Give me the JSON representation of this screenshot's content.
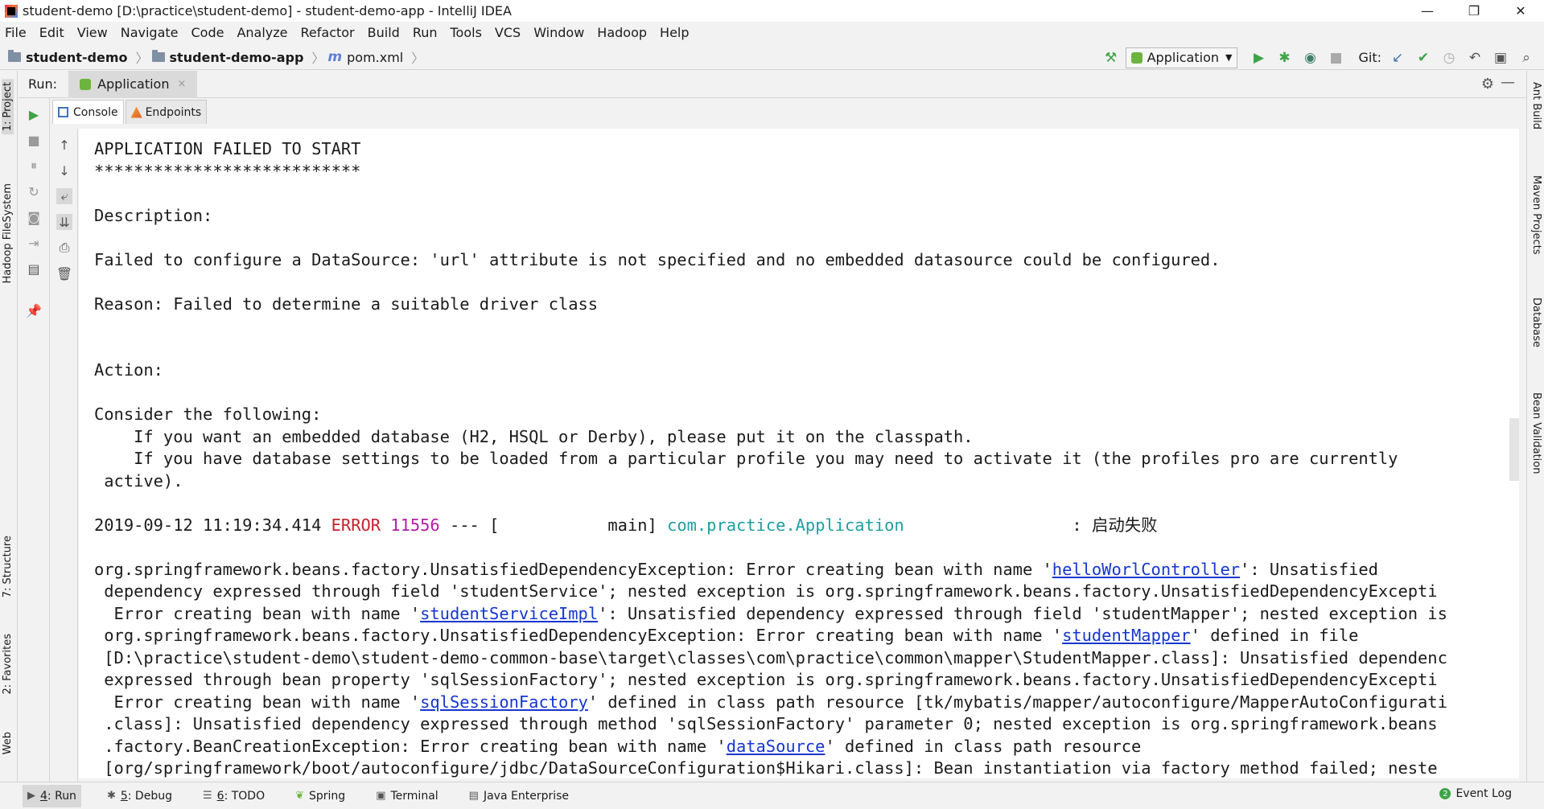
{
  "window": {
    "title": "student-demo [D:\\practice\\student-demo] - student-demo-app - IntelliJ IDEA",
    "minimize": "—",
    "restore": "❐",
    "close": "✕"
  },
  "menu": [
    "File",
    "Edit",
    "View",
    "Navigate",
    "Code",
    "Analyze",
    "Refactor",
    "Build",
    "Run",
    "Tools",
    "VCS",
    "Window",
    "Hadoop",
    "Help"
  ],
  "breadcrumb": {
    "project": "student-demo",
    "module": "student-demo-app",
    "file_icon": "m",
    "file": "pom.xml",
    "sep": "〉"
  },
  "toolbar": {
    "run_config": "Application",
    "git_label": "Git:"
  },
  "run_window": {
    "label": "Run:",
    "tab": "Application",
    "tab_close": "×"
  },
  "console_tabs": {
    "console": "Console",
    "endpoints": "Endpoints"
  },
  "left_tabs": [
    "1: Project",
    "Hadoop FileSystem",
    "7: Structure",
    "2: Favorites",
    "Web"
  ],
  "right_tabs": [
    "Ant Build",
    "Maven Projects",
    "Database",
    "Bean Validation"
  ],
  "console": {
    "lines": [
      "APPLICATION FAILED TO START",
      "***************************",
      "",
      "Description:",
      "",
      "Failed to configure a DataSource: 'url' attribute is not specified and no embedded datasource could be configured.",
      "",
      "Reason: Failed to determine a suitable driver class",
      "",
      "",
      "Action:",
      "",
      "Consider the following:",
      "    If you want an embedded database (H2, HSQL or Derby), please put it on the classpath.",
      "    If you have database settings to be loaded from a particular profile you may need to activate it (the profiles pro are currently",
      " active).",
      ""
    ],
    "log": {
      "timestamp": "2019-09-12 11:19:34.414 ",
      "level": "ERROR",
      "pid": " 11556",
      "thread": " --- [           main] ",
      "logger": "com.practice.Application",
      "message": "                 : 启动失败"
    },
    "exception": {
      "l1a": "org.springframework.beans.factory.UnsatisfiedDependencyException: Error creating bean with name '",
      "l1link": "helloWorlController",
      "l1b": "': Unsatisfied",
      "l2": " dependency expressed through field 'studentService'; nested exception is org.springframework.beans.factory.UnsatisfiedDependencyExcepti",
      "l3a": "  Error creating bean with name '",
      "l3link": "studentServiceImpl",
      "l3b": "': Unsatisfied dependency expressed through field 'studentMapper'; nested exception is",
      "l4a": " org.springframework.beans.factory.UnsatisfiedDependencyException: Error creating bean with name '",
      "l4link": "studentMapper",
      "l4b": "' defined in file",
      "l5": " [D:\\practice\\student-demo\\student-demo-common-base\\target\\classes\\com\\practice\\common\\mapper\\StudentMapper.class]: Unsatisfied dependenc",
      "l6": " expressed through bean property 'sqlSessionFactory'; nested exception is org.springframework.beans.factory.UnsatisfiedDependencyExcepti",
      "l7a": "  Error creating bean with name '",
      "l7link": "sqlSessionFactory",
      "l7b": "' defined in class path resource [tk/mybatis/mapper/autoconfigure/MapperAutoConfigurati",
      "l8": " .class]: Unsatisfied dependency expressed through method 'sqlSessionFactory' parameter 0; nested exception is org.springframework.beans",
      "l9a": " .factory.BeanCreationException: Error creating bean with name '",
      "l9link": "dataSource",
      "l9b": "' defined in class path resource",
      "l10": " [org/springframework/boot/autoconfigure/jdbc/DataSourceConfiguration$Hikari.class]: Bean instantiation via factory method failed; neste"
    }
  },
  "bottom_tabs": [
    {
      "num": "4",
      "label": ": Run"
    },
    {
      "num": "5",
      "label": ": Debug"
    },
    {
      "num": "6",
      "label": ": TODO"
    },
    {
      "num": "",
      "label": "Spring"
    },
    {
      "num": "",
      "label": "Terminal"
    },
    {
      "num": "",
      "label": "Java Enterprise"
    }
  ],
  "event_log": "Event Log",
  "colors": {
    "error": "#c7222d",
    "pid": "#b01ea8",
    "logger": "#1f9ea1",
    "link": "#1636d0",
    "run_green": "#3fa348"
  },
  "icons": {
    "hammer": "⚒",
    "run": "▶",
    "debug": "✱",
    "coverage": "◉",
    "stop": "■",
    "git_update": "↙",
    "git_commit": "✔",
    "history": "◷",
    "revert": "↶",
    "project_structure": "▣",
    "search": "⌕",
    "gear": "⚙",
    "minimize_panel": "—",
    "up": "↑",
    "down": "↓",
    "wrap": "⤶",
    "scroll_end": "⇊",
    "print": "⎙",
    "trash": "🗑",
    "rerun": "▶",
    "stop_run": "■",
    "pause": "⏸",
    "restore_layout": "↻",
    "screenshot": "◙",
    "exit": "⇥",
    "layout": "▤",
    "pin": "📌"
  }
}
